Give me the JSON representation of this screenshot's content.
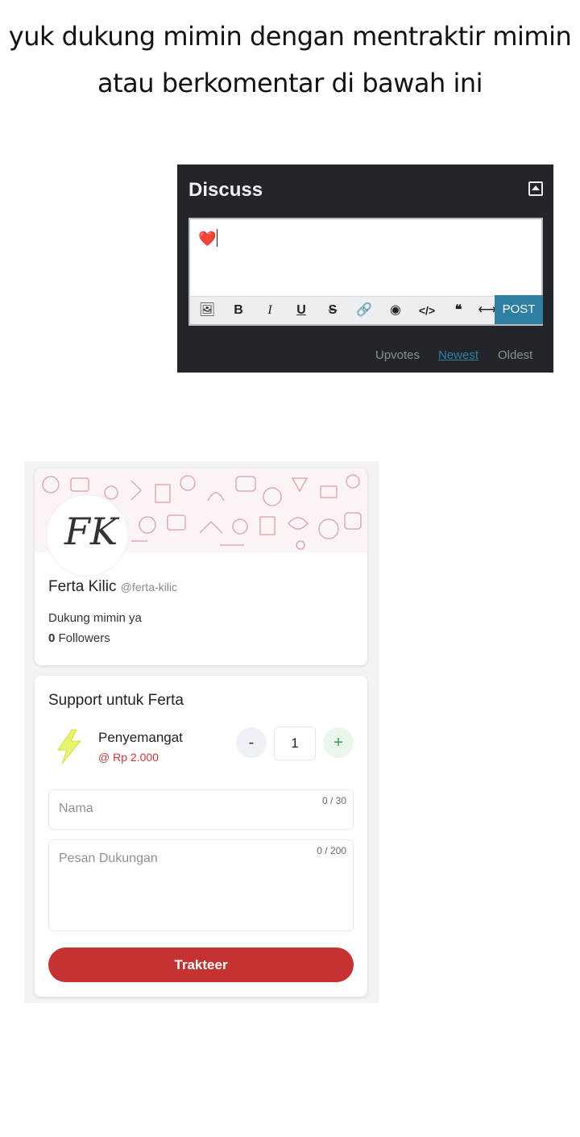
{
  "caption": {
    "line1": "yuk dukung mimin dengan mentraktir mimin",
    "line2": "atau berkomentar di bawah ini"
  },
  "discuss": {
    "title": "Discuss",
    "editor_content": "❤️",
    "toolbar": {
      "image": "🖼",
      "bold": "B",
      "italic": "I",
      "underline": "U",
      "strike": "S",
      "link": "🔗",
      "spoiler": "◉",
      "code": "</>",
      "quote": "❝",
      "more": "⟷",
      "post_label": "POST"
    },
    "sort": {
      "upvotes": "Upvotes",
      "newest": "Newest",
      "oldest": "Oldest",
      "active": "Newest"
    },
    "colors": {
      "background": "#22262b",
      "accent": "#2e7fa1"
    }
  },
  "trakteer": {
    "profile": {
      "avatar_initials": "FK",
      "name": "Ferta Kilic",
      "handle": "@ferta-kilic",
      "bio": "Dukung mimin ya",
      "followers_count": "0",
      "followers_label": "Followers"
    },
    "support": {
      "title": "Support untuk Ferta",
      "unit_name": "Penyemangat",
      "unit_price": "@ Rp 2.000",
      "quantity": "1",
      "minus_label": "-",
      "plus_label": "+",
      "name_placeholder": "Nama",
      "name_counter": "0 / 30",
      "message_placeholder": "Pesan Dukungan",
      "message_counter": "0 / 200",
      "button_label": "Trakteer"
    },
    "colors": {
      "brand": "#c53232",
      "price": "#c2373c"
    }
  }
}
